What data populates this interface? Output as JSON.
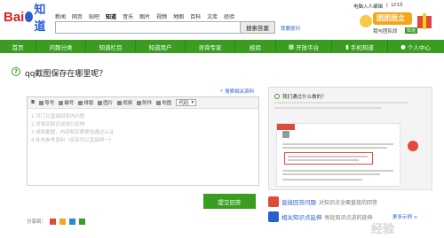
{
  "topnav": [
    "新闻",
    "网页",
    "贴吧",
    "知道",
    "音乐",
    "图片",
    "视频",
    "地图",
    "百科",
    "文库",
    "经验"
  ],
  "topnav_active": "知道",
  "userbar": [
    "电脑入人编辑",
    "|",
    "LY15"
  ],
  "logo": {
    "text1": "Bai",
    "text2": "知道"
  },
  "search": {
    "value": "",
    "button": "搜索答案",
    "ask_link": "我要提问"
  },
  "banner": {
    "title": "团团而立",
    "subtitle": "我与团队同",
    "tag": "知道"
  },
  "mainnav": [
    "首页",
    "问题分类",
    "知道栏目",
    "知道用户",
    "咨询专家",
    "经验",
    "开放平台",
    "手机知道",
    "个人中心"
  ],
  "question": {
    "title": "qq截图保存在哪里呢？"
  },
  "search_related": "搜索相关资料",
  "toolbar": [
    "导号",
    "编号",
    "排版",
    "图片",
    "视频",
    "附件",
    "地图"
  ],
  "code_select": "代码",
  "hints": [
    "1.可门以直接回答内问题",
    "2.对相关知识讲进行延伸",
    "3.或附截图，内容和实质更加通过认证",
    "4.补充参考资料（仅有可以直接帮一）"
  ],
  "submit": "提交回答",
  "share_label": "分享到：",
  "right_panel": {
    "head": "我们通过什么做的？"
  },
  "features": [
    {
      "title": "直接回答问题",
      "desc": "对知识点全面直接的回答"
    },
    {
      "title": "相关知识点延伸",
      "desc": "每处知识点进的延伸"
    }
  ],
  "more": "更多示例 >",
  "watermark": "经验",
  "colors": {
    "green": "#3a9d21",
    "blue": "#2a5fd0",
    "red": "#e04a3a"
  }
}
